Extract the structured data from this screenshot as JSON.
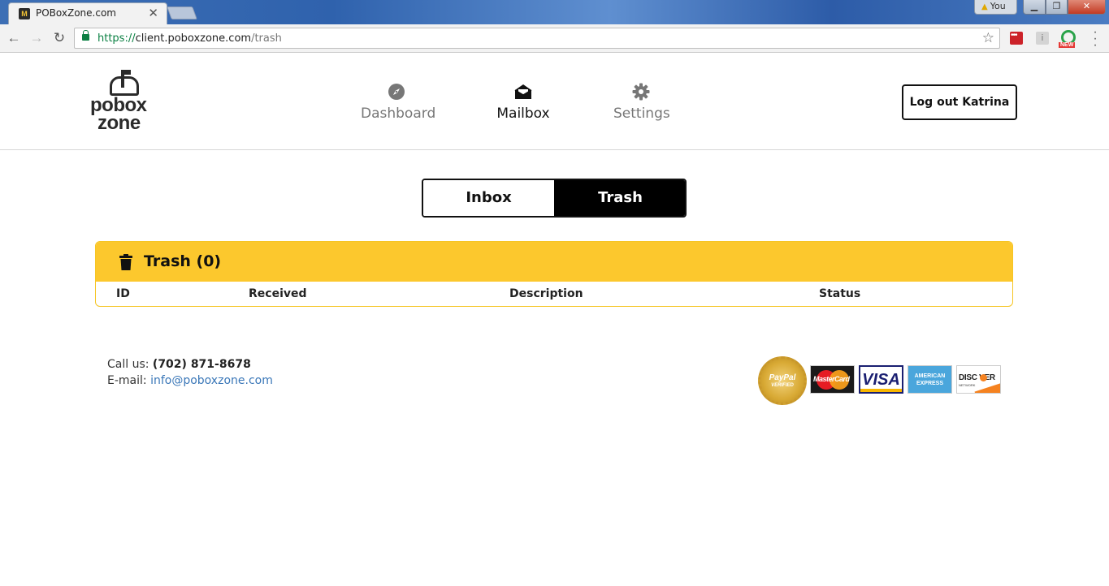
{
  "browser": {
    "tab_title": "POBoxZone.com",
    "favicon_text": "M",
    "tab_close": "✕",
    "profile_label": "You",
    "url_scheme": "https://",
    "url_host": "client.poboxzone.com",
    "url_path": "/trash",
    "ext_info": "i",
    "ext_new_badge": "NEW"
  },
  "site": {
    "logo_line1": "pobox",
    "logo_line2": "zone",
    "nav": [
      {
        "label": "Dashboard",
        "icon": "compass-icon",
        "active": false
      },
      {
        "label": "Mailbox",
        "icon": "envelope-open-icon",
        "active": true
      },
      {
        "label": "Settings",
        "icon": "gear-icon",
        "active": false
      }
    ],
    "logout_label": "Log out Katrina"
  },
  "toggle": {
    "inbox_label": "Inbox",
    "trash_label": "Trash",
    "selected": "Trash"
  },
  "panel": {
    "title": "Trash (0)",
    "columns": [
      "ID",
      "Received",
      "Description",
      "Status"
    ],
    "rows": []
  },
  "footer": {
    "call_label": "Call us:",
    "phone": "(702) 871-8678",
    "email_label": "E-mail:",
    "email": "info@poboxzone.com",
    "paypal_line1": "PayPal",
    "paypal_line2": "VERIFIED",
    "mastercard_text": "MasterCard",
    "visa_text": "VISA",
    "amex_line1": "AMERICAN",
    "amex_line2": "EXPRESS",
    "discover_text": "DISC  VER",
    "discover_sub": "NETWORK"
  },
  "colors": {
    "accent_yellow": "#fcc82d",
    "link_blue": "#3a77b8",
    "secure_green": "#0b8043"
  }
}
